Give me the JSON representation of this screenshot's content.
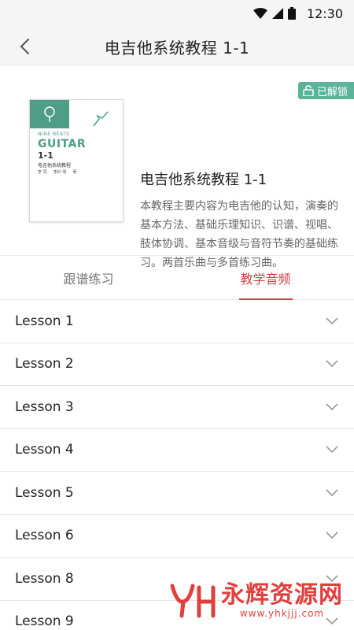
{
  "status": {
    "time": "12:30"
  },
  "header": {
    "title": "电吉他系统教程 1-1"
  },
  "badge": {
    "label": "已解锁"
  },
  "book": {
    "brand": "NINE BEATS",
    "guitar": "GUITAR",
    "num": "1-1",
    "cn": "电吉他系统教程",
    "authors": "李 同 　 李红 明 　 著"
  },
  "course": {
    "title": "电吉他系统教程 1-1",
    "description": "本教程主要内容为电吉他的认知，演奏的基本方法、基础乐理知识、识谱、视唱、肢体协调、基本音级与音符节奏的基础练习。两首乐曲与多首练习曲。"
  },
  "tabs": [
    {
      "label": "跟谱练习",
      "active": false
    },
    {
      "label": "教学音频",
      "active": true
    }
  ],
  "lessons": [
    {
      "label": "Lesson 1"
    },
    {
      "label": "Lesson 2"
    },
    {
      "label": "Lesson 3"
    },
    {
      "label": "Lesson 4"
    },
    {
      "label": "Lesson 5"
    },
    {
      "label": "Lesson 6"
    },
    {
      "label": "Lesson 8"
    },
    {
      "label": "Lesson 9"
    }
  ],
  "watermark": {
    "text": "永辉资源网",
    "url": "www.yhkjjj.com"
  },
  "colors": {
    "accent": "#d23c44",
    "badge": "#5bb39a",
    "book_green": "#4e9e87"
  }
}
